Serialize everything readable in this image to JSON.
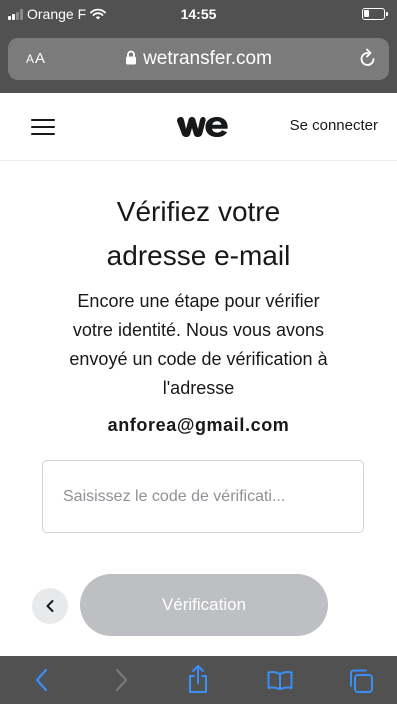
{
  "status_bar": {
    "carrier": "Orange F",
    "time": "14:55"
  },
  "browser": {
    "text_size_label_small": "A",
    "text_size_label_large": "A",
    "url": "wetransfer.com"
  },
  "header": {
    "signin_label": "Se connecter"
  },
  "main": {
    "title_line1": "Vérifiez votre",
    "title_line2": "adresse e-mail",
    "desc_line1": "Encore une étape pour vérifier",
    "desc_line2": "votre identité. Nous vous avons",
    "desc_line3": "envoyé un code de vérification à",
    "desc_line4": "l'adresse",
    "email": "anforea@gmail.com",
    "code_input": {
      "placeholder": "Saisissez le code de vérificati...",
      "value": ""
    },
    "verify_label": "Vérification"
  },
  "colors": {
    "chrome": "#515151",
    "url_bar": "#7b7b7b",
    "toolbar_accent": "#3a8ef6",
    "button_disabled": "#bdbfc2",
    "text": "#17181a"
  },
  "icons": {
    "lock": "lock-icon",
    "reload": "reload-icon",
    "menu": "hamburger-icon",
    "back": "chevron-left-icon",
    "nav_back": "arrow-back-icon",
    "nav_forward": "arrow-forward-icon",
    "share": "share-icon",
    "bookmarks": "book-icon",
    "tabs": "tabs-icon"
  }
}
